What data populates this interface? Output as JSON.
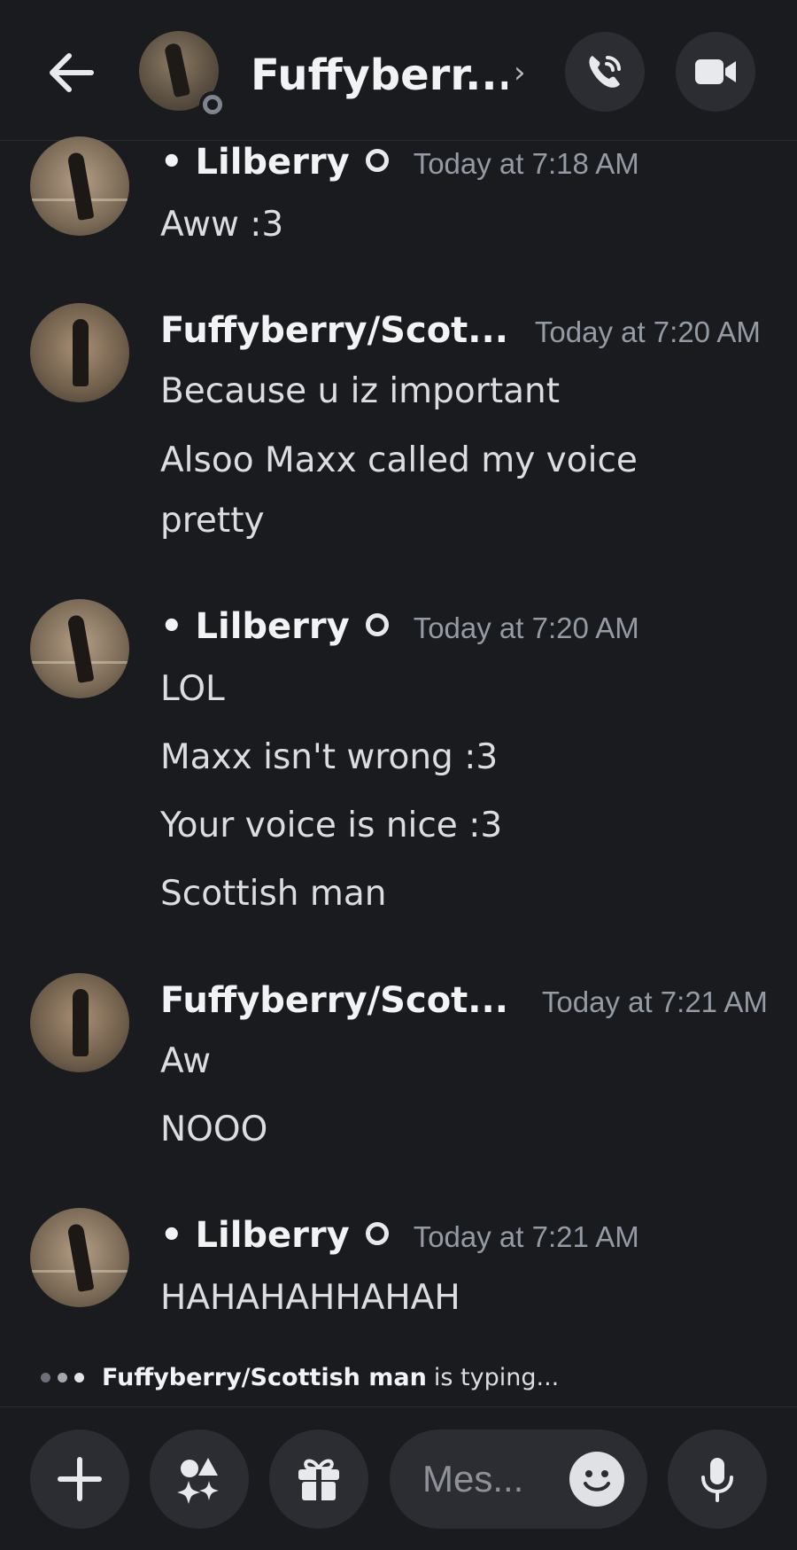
{
  "header": {
    "title": "Fuffyberr...",
    "chevron": "›",
    "back_icon": "arrow-left-icon",
    "call_icon": "phone-call-icon",
    "video_icon": "video-camera-icon"
  },
  "messages": [
    {
      "author": "• Lilberry",
      "timestamp": "Today at 7:18 AM",
      "lines": [
        "Aww :3"
      ]
    },
    {
      "author": "Fuffyberry/Scot...",
      "timestamp": "Today at 7:20 AM",
      "lines": [
        "Because u iz important",
        "Alsoo Maxx called my voice",
        "pretty"
      ]
    },
    {
      "author": "• Lilberry",
      "timestamp": "Today at 7:20 AM",
      "lines": [
        "LOL",
        "Maxx isn't wrong :3",
        "Your voice is nice :3",
        "Scottish man"
      ]
    },
    {
      "author": "Fuffyberry/Scot...",
      "timestamp": "Today at 7:21 AM",
      "lines": [
        "Aw",
        "NOOO"
      ]
    },
    {
      "author": "• Lilberry",
      "timestamp": "Today at 7:21 AM",
      "lines": [
        "HAHAHAHHAHAH"
      ]
    }
  ],
  "typing": {
    "name": "Fuffyberry/Scottish man",
    "rest": "is typing..."
  },
  "composer": {
    "placeholder": "Mes...",
    "plus_icon": "plus-icon",
    "apps_icon": "apps-icon",
    "gift_icon": "gift-icon",
    "emoji_icon": "emoji-icon",
    "mic_icon": "microphone-icon"
  },
  "colors": {
    "background": "#1a1b1f",
    "button_bg": "#2b2d33",
    "timestamp": "#949ba4",
    "text": "#dbdee1"
  }
}
